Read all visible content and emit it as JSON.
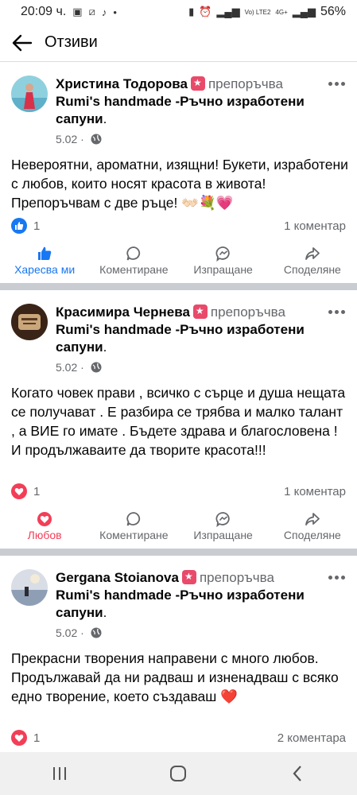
{
  "status_bar": {
    "time": "20:09 ч.",
    "network_label": "Vo) LTE2",
    "network_speed": "4G+",
    "battery": "56%"
  },
  "header": {
    "title": "Отзиви"
  },
  "reviews": [
    {
      "author": "Христина Тодорова",
      "recommends": "препоръчва",
      "page": "Rumi's handmade -Ръчно изработени сапуни",
      "date": "5.02 ·",
      "text": "Невероятни, ароматни, изящни! Букети, изработени с любов, които носят красота в живота! Препоръчвам с две ръце! 👐🏻💐💗",
      "reaction_count": "1",
      "reaction_type": "like",
      "comments": "1 коментар",
      "actions": [
        "Харесва ми",
        "Коментиране",
        "Изпращане",
        "Споделяне"
      ]
    },
    {
      "author": "Красимира Чернева",
      "recommends": "препоръчва",
      "page": "Rumi's handmade -Ръчно изработени сапуни",
      "date": "5.02 ·",
      "text": "Когато човек прави , всичко с сърце и душа нещата се получават . Е разбира се трябва и малко талант , а ВИЕ го имате . Бъдете здрава и благословена ! И продължаваите да творите красота!!!",
      "reaction_count": "1",
      "reaction_type": "love",
      "comments": "1 коментар",
      "actions": [
        "Любов",
        "Коментиране",
        "Изпращане",
        "Споделяне"
      ]
    },
    {
      "author": "Gergana Stoianova",
      "recommends": "препоръчва",
      "page": "Rumi's handmade -Ръчно изработени сапуни",
      "date": "5.02 ·",
      "text": "Прекрасни творения направени с много любов. Продължавай да ни радваш и изненадваш с всяко едно творение, което създаваш ❤️",
      "reaction_count": "1",
      "reaction_type": "love",
      "comments": "2 коментара"
    }
  ],
  "colors": {
    "facebook_blue": "#1877f2",
    "love_red": "#f33e58",
    "recommend_badge": "#e94a6a",
    "secondary_text": "#65676b"
  }
}
